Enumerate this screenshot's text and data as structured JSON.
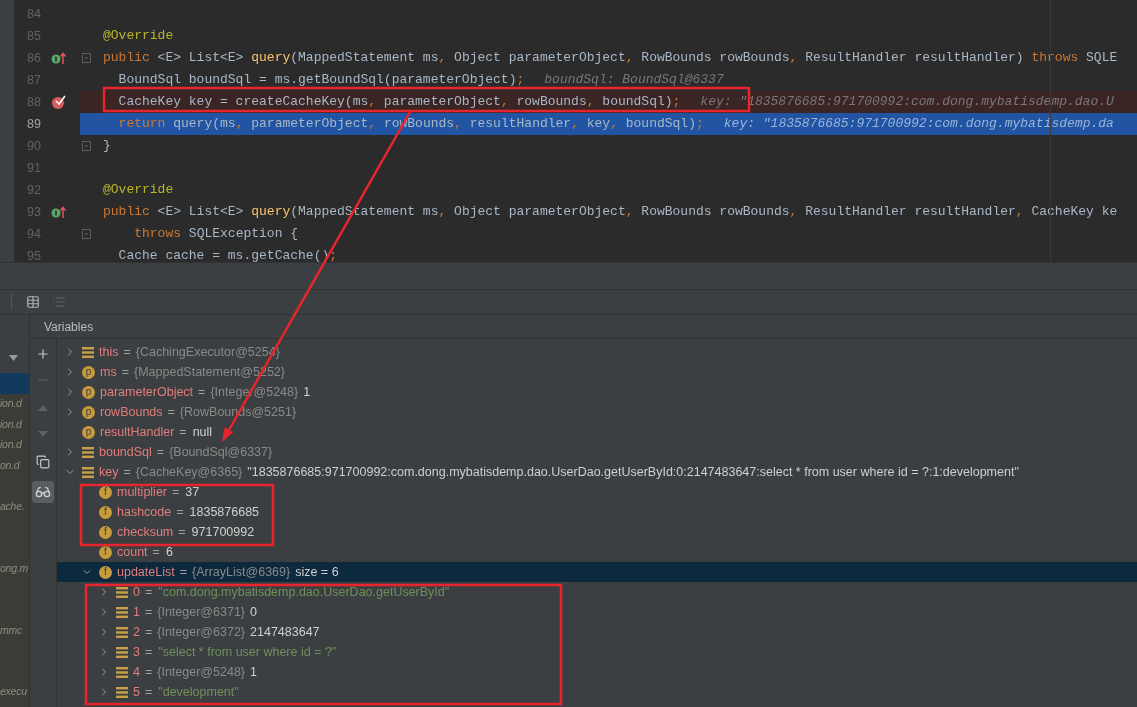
{
  "editor": {
    "lines": [
      {
        "number": "84",
        "current": false,
        "kind": "plain"
      },
      {
        "number": "85",
        "current": false,
        "kind": "plain",
        "tokens": [
          {
            "kind": "ann",
            "text": "@Override"
          }
        ]
      },
      {
        "number": "86",
        "current": false,
        "kind": "override",
        "fold": true,
        "tokens": [
          {
            "kind": "kw",
            "text": "public "
          },
          {
            "kind": "txt",
            "text": "<E> List<E> "
          },
          {
            "kind": "fn",
            "text": "query"
          },
          {
            "kind": "txt",
            "text": "(MappedStatement ms"
          },
          {
            "kind": "kw",
            "text": ", "
          },
          {
            "kind": "txt",
            "text": "Object parameterObject"
          },
          {
            "kind": "kw",
            "text": ", "
          },
          {
            "kind": "txt",
            "text": "RowBounds rowBounds"
          },
          {
            "kind": "kw",
            "text": ", "
          },
          {
            "kind": "txt",
            "text": "ResultHandler resultHandler) "
          },
          {
            "kind": "kw",
            "text": "throws "
          },
          {
            "kind": "txt",
            "text": "SQLE"
          }
        ]
      },
      {
        "number": "87",
        "current": false,
        "kind": "plain",
        "tokens": [
          {
            "kind": "txt",
            "text": "  BoundSql boundSql = ms.getBoundSql(parameterObject)"
          },
          {
            "kind": "kw",
            "text": ";"
          }
        ],
        "hint": "boundSql: BoundSql@6337"
      },
      {
        "number": "88",
        "current": false,
        "kind": "breakpoint",
        "tokens": [
          {
            "kind": "txt",
            "text": "  CacheKey key = createCacheKey(ms"
          },
          {
            "kind": "kw",
            "text": ", "
          },
          {
            "kind": "txt",
            "text": "parameterObject"
          },
          {
            "kind": "kw",
            "text": ", "
          },
          {
            "kind": "txt",
            "text": "rowBounds"
          },
          {
            "kind": "kw",
            "text": ", "
          },
          {
            "kind": "txt",
            "text": "boundSql)"
          },
          {
            "kind": "kw",
            "text": ";"
          }
        ],
        "hint": "key: \"1835876685:971700992:com.dong.mybatisdemp.dao.U"
      },
      {
        "number": "89",
        "current": true,
        "kind": "plain",
        "tokens": [
          {
            "kind": "kw",
            "text": "  return "
          },
          {
            "kind": "txt",
            "text": "query(ms"
          },
          {
            "kind": "kw",
            "text": ", "
          },
          {
            "kind": "txt",
            "text": "parameterObject"
          },
          {
            "kind": "kw",
            "text": ", "
          },
          {
            "kind": "txt",
            "text": "rowBounds"
          },
          {
            "kind": "kw",
            "text": ", "
          },
          {
            "kind": "txt",
            "text": "resultHandler"
          },
          {
            "kind": "kw",
            "text": ", "
          },
          {
            "kind": "txt",
            "text": "key"
          },
          {
            "kind": "kw",
            "text": ", "
          },
          {
            "kind": "txt",
            "text": "boundSql)"
          },
          {
            "kind": "kw",
            "text": ";"
          }
        ],
        "hint": "key: \"1835876685:971700992:com.dong.mybatisdemp.da"
      },
      {
        "number": "90",
        "current": false,
        "kind": "plain",
        "fold": true,
        "tokens": [
          {
            "kind": "txt",
            "text": "}"
          }
        ]
      },
      {
        "number": "91",
        "current": false,
        "kind": "plain"
      },
      {
        "number": "92",
        "current": false,
        "kind": "plain",
        "tokens": [
          {
            "kind": "ann",
            "text": "@Override"
          }
        ]
      },
      {
        "number": "93",
        "current": false,
        "kind": "override",
        "tokens": [
          {
            "kind": "kw",
            "text": "public "
          },
          {
            "kind": "txt",
            "text": "<E> List<E> "
          },
          {
            "kind": "fn",
            "text": "query"
          },
          {
            "kind": "txt",
            "text": "(MappedStatement ms"
          },
          {
            "kind": "kw",
            "text": ", "
          },
          {
            "kind": "txt",
            "text": "Object parameterObject"
          },
          {
            "kind": "kw",
            "text": ", "
          },
          {
            "kind": "txt",
            "text": "RowBounds rowBounds"
          },
          {
            "kind": "kw",
            "text": ", "
          },
          {
            "kind": "txt",
            "text": "ResultHandler resultHandler"
          },
          {
            "kind": "kw",
            "text": ", "
          },
          {
            "kind": "txt",
            "text": "CacheKey ke"
          }
        ]
      },
      {
        "number": "94",
        "current": false,
        "kind": "plain",
        "fold": true,
        "tokens": [
          {
            "kind": "kw",
            "text": "    throws "
          },
          {
            "kind": "txt",
            "text": "SQLException {"
          }
        ]
      },
      {
        "number": "95",
        "current": false,
        "kind": "plain",
        "tokens": [
          {
            "kind": "txt",
            "text": "  Cache cache = ms.getCache()"
          },
          {
            "kind": "kw",
            "text": ";"
          }
        ]
      }
    ]
  },
  "frames": [
    {
      "selected": true
    },
    {
      "text": "ion.d",
      "selected": false
    },
    {
      "text": "ion.d",
      "selected": false
    },
    {
      "text": "ion.d",
      "selected": false
    },
    {
      "text": "on.d",
      "selected": false
    },
    {
      "selected": false
    },
    {
      "text": "ache.",
      "selected": false
    },
    {
      "selected": false
    },
    {
      "selected": false
    },
    {
      "text": "ong.m",
      "selected": false
    },
    {
      "selected": false
    },
    {
      "selected": false
    },
    {
      "text": "mmc",
      "selected": false
    },
    {
      "selected": false
    },
    {
      "selected": false
    },
    {
      "text": "execu",
      "selected": false
    }
  ],
  "variables": {
    "title": "Variables",
    "rows": [
      {
        "kind": "local",
        "name": "this",
        "operator": "=",
        "type": "{CachingExecutor@5254}",
        "expanded": false,
        "selected": false
      },
      {
        "kind": "param",
        "badge": "p",
        "name": "ms",
        "operator": "=",
        "type": "{MappedStatement@5252}",
        "expanded": false,
        "selected": false
      },
      {
        "kind": "param",
        "badge": "p",
        "name": "parameterObject",
        "operator": "=",
        "type": "{Integer@5248}",
        "value": "1",
        "is_string": false,
        "expanded": false,
        "selected": false
      },
      {
        "kind": "param",
        "badge": "p",
        "name": "rowBounds",
        "operator": "=",
        "type": "{RowBounds@5251}",
        "expanded": false,
        "selected": false
      },
      {
        "kind": "param",
        "badge": "p",
        "name": "resultHandler",
        "operator": "=",
        "value": "null",
        "is_string": false,
        "selected": false
      },
      {
        "kind": "local",
        "name": "boundSql",
        "operator": "=",
        "type": "{BoundSql@6337}",
        "expanded": false,
        "selected": false
      },
      {
        "kind": "local",
        "name": "key",
        "operator": "=",
        "type": "{CacheKey@6365}",
        "value": "\"1835876685:971700992:com.dong.mybatisdemp.dao.UserDao.getUserById:0:2147483647:select * from user where id = ?:1:development\"",
        "is_string": false,
        "expanded": true,
        "selected": false,
        "children": [
          {
            "kind": "field",
            "badge": "f",
            "name": "multiplier",
            "operator": "=",
            "value": "37",
            "is_string": false,
            "selected": false
          },
          {
            "kind": "field",
            "badge": "f",
            "name": "hashcode",
            "operator": "=",
            "value": "1835876685",
            "is_string": false,
            "selected": false
          },
          {
            "kind": "field",
            "badge": "f",
            "name": "checksum",
            "operator": "=",
            "value": "971700992",
            "is_string": false,
            "selected": false
          },
          {
            "kind": "field",
            "badge": "f",
            "name": "count",
            "operator": "=",
            "value": "6",
            "is_string": false,
            "selected": false
          },
          {
            "kind": "field",
            "badge": "f",
            "name": "updateList",
            "operator": "=",
            "type": "{ArrayList@6369}",
            "value": "size = 6",
            "is_string": false,
            "expanded": true,
            "selected": true,
            "children": [
              {
                "kind": "local",
                "name": "0",
                "operator": "=",
                "value": "\"com.dong.mybatisdemp.dao.UserDao.getUserById\"",
                "is_string": true,
                "expanded": false,
                "selected": false
              },
              {
                "kind": "local",
                "name": "1",
                "operator": "=",
                "type": "{Integer@6371}",
                "value": "0",
                "is_string": false,
                "expanded": false,
                "selected": false
              },
              {
                "kind": "local",
                "name": "2",
                "operator": "=",
                "type": "{Integer@6372}",
                "value": "2147483647",
                "is_string": false,
                "expanded": false,
                "selected": false
              },
              {
                "kind": "local",
                "name": "3",
                "operator": "=",
                "value": "\"select * from user where id = ?\"",
                "is_string": true,
                "expanded": false,
                "selected": false
              },
              {
                "kind": "local",
                "name": "4",
                "operator": "=",
                "type": "{Integer@5248}",
                "value": "1",
                "is_string": false,
                "expanded": false,
                "selected": false
              },
              {
                "kind": "local",
                "name": "5",
                "operator": "=",
                "value": "\"development\"",
                "is_string": true,
                "expanded": false,
                "selected": false
              }
            ]
          }
        ]
      }
    ]
  },
  "annotations": [
    {
      "kind": "box"
    },
    {
      "kind": "box"
    },
    {
      "kind": "box"
    },
    {
      "kind": "arrow"
    }
  ]
}
